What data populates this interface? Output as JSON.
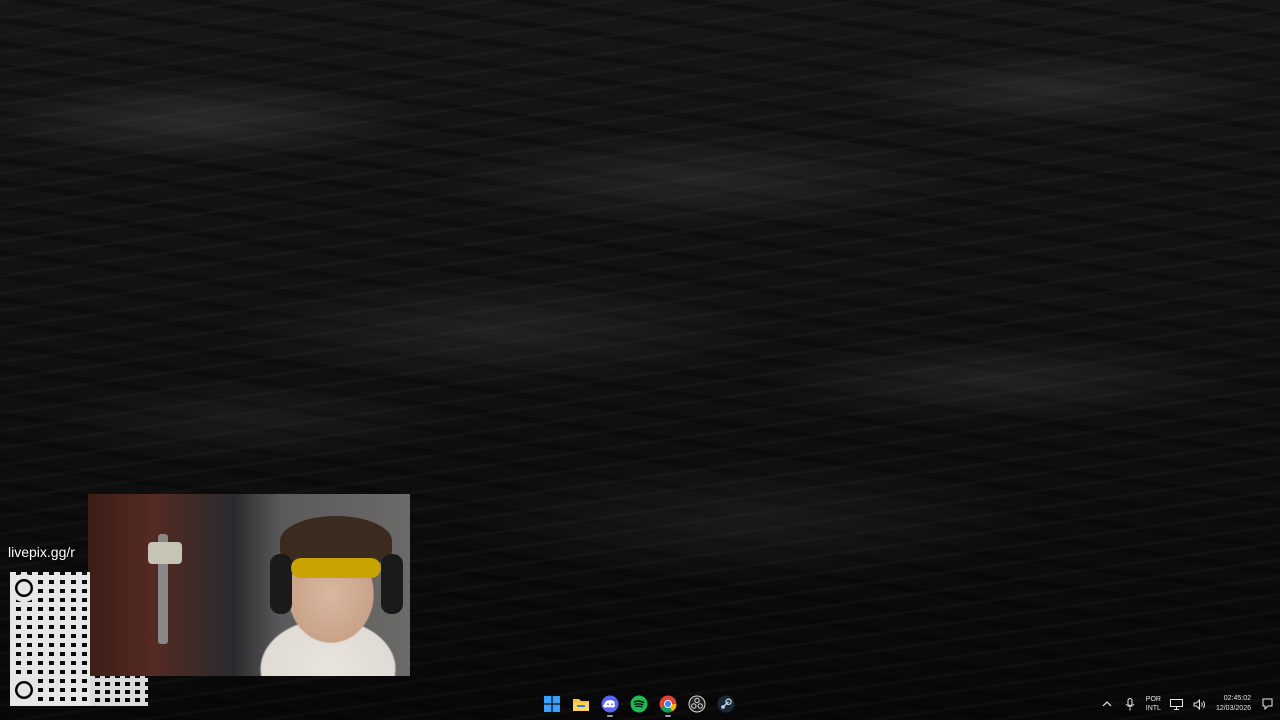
{
  "overlay": {
    "livepix_text": "livepix.gg/r"
  },
  "taskbar": {
    "pinned": [
      {
        "name": "start",
        "icon": "windows-logo-icon",
        "color": "#0a84ff"
      },
      {
        "name": "file-explorer",
        "icon": "folder-icon",
        "color": "#f6c343"
      },
      {
        "name": "discord",
        "icon": "discord-icon",
        "color": "#5865f2"
      },
      {
        "name": "spotify",
        "icon": "spotify-icon",
        "color": "#1db954"
      },
      {
        "name": "chrome",
        "icon": "chrome-icon",
        "color": "#db4437"
      },
      {
        "name": "obs",
        "icon": "obs-icon",
        "color": "#d9d9d9"
      },
      {
        "name": "steam",
        "icon": "steam-icon",
        "color": "#c7d5e0"
      }
    ],
    "tray": {
      "language_top": "POR",
      "language_bottom": "INTL",
      "time": "02:45:02",
      "date": "12/03/2026"
    }
  }
}
